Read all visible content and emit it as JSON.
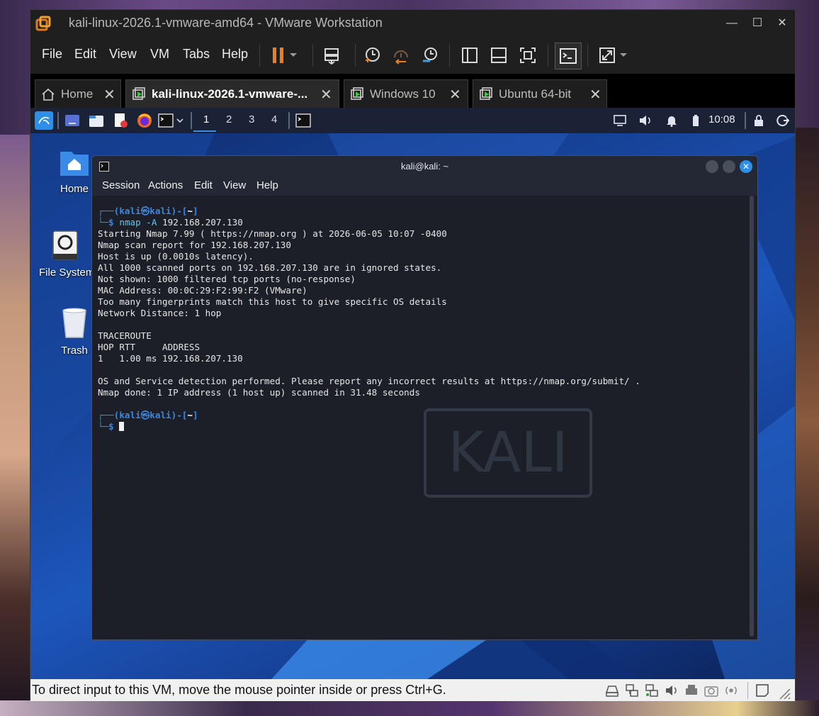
{
  "window": {
    "title": "kali-linux-2026.1-vmware-amd64 - VMware Workstation",
    "controls": {
      "minimize": "—",
      "maximize": "☐",
      "close": "✕"
    }
  },
  "menu": [
    "File",
    "Edit",
    "View",
    "VM",
    "Tabs",
    "Help"
  ],
  "toolbar": {
    "icons": [
      "pause-icon",
      "dropdown-icon",
      "send-ctrl-alt-del-icon",
      "snapshot-take-icon",
      "snapshot-revert-icon",
      "snapshot-manager-icon",
      "library-view-icon",
      "thumbnail-view-icon",
      "fullscreen-icon",
      "console-view-icon",
      "stretch-icon"
    ]
  },
  "tabs": [
    {
      "label": "Home",
      "icon": "home-icon",
      "active": false
    },
    {
      "label": "kali-linux-2026.1-vmware-...",
      "icon": "vm-icon",
      "active": true
    },
    {
      "label": "Windows 10",
      "icon": "vm-icon",
      "active": false
    },
    {
      "label": "Ubuntu 64-bit",
      "icon": "vm-icon",
      "active": false
    }
  ],
  "vm_panel": {
    "workspaces": [
      "1",
      "2",
      "3",
      "4"
    ],
    "active_workspace": "1",
    "clock": "10:08"
  },
  "desktop_icons": [
    {
      "label": "Home",
      "icon": "home-folder-icon"
    },
    {
      "label": "File System",
      "icon": "drive-icon"
    },
    {
      "label": "Trash",
      "icon": "trash-icon"
    }
  ],
  "terminal": {
    "title": "kali@kali: ~",
    "menu": [
      "Session",
      "Actions",
      "Edit",
      "View",
      "Help"
    ],
    "prompt": {
      "user": "kali",
      "at": "㉿",
      "host": "kali",
      "dir": "~",
      "symbol": "$"
    },
    "command": "nmap -A 192.168.207.130",
    "command_name": "nmap",
    "command_flag": "-A",
    "command_arg": "192.168.207.130",
    "output": [
      "Starting Nmap 7.99 ( https://nmap.org ) at 2026-06-05 10:07 -0400",
      "Nmap scan report for 192.168.207.130",
      "Host is up (0.0010s latency).",
      "All 1000 scanned ports on 192.168.207.130 are in ignored states.",
      "Not shown: 1000 filtered tcp ports (no-response)",
      "MAC Address: 00:0C:29:F2:99:F2 (VMware)",
      "Too many fingerprints match this host to give specific OS details",
      "Network Distance: 1 hop",
      "",
      "TRACEROUTE",
      "HOP RTT     ADDRESS",
      "1   1.00 ms 192.168.207.130",
      "",
      "OS and Service detection performed. Please report any incorrect results at https://nmap.org/submit/ .",
      "Nmap done: 1 IP address (1 host up) scanned in 31.48 seconds"
    ],
    "watermark": "KALI"
  },
  "statusbar": {
    "message": "To direct input to this VM, move the mouse pointer inside or press Ctrl+G."
  }
}
